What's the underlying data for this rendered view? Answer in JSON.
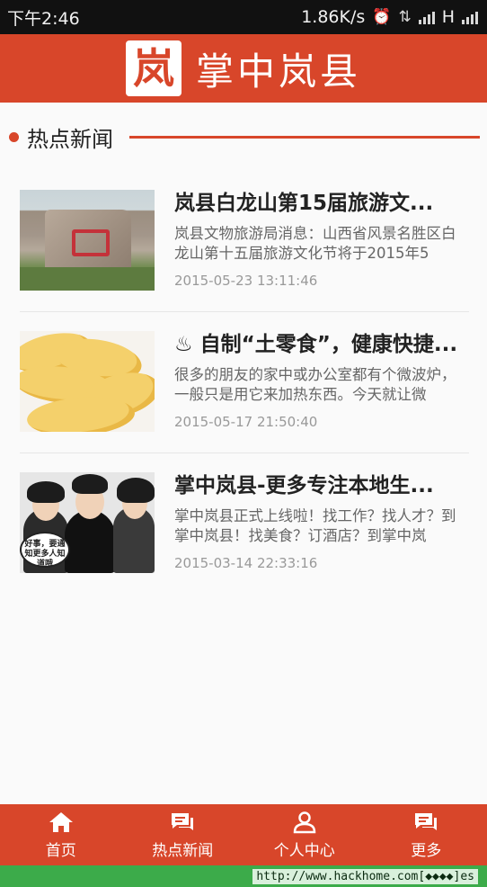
{
  "status_bar": {
    "time": "下午2:46",
    "speed": "1.86K/s",
    "network": "H"
  },
  "header": {
    "logo_char": "岚",
    "title": "掌中岚县"
  },
  "section": {
    "title": "热点新闻"
  },
  "news": [
    {
      "title": "岚县白龙山第15届旅游文...",
      "summary": "岚县文物旅游局消息：山西省风景名胜区白龙山第十五届旅游文化节将于2015年5",
      "date": "2015-05-23 13:11:46"
    },
    {
      "title": "♨ 自制“土零食”，健康快捷...",
      "summary": "很多的朋友的家中或办公室都有个微波炉，一般只是用它来加热东西。今天就让微",
      "date": "2015-05-17 21:50:40"
    },
    {
      "title": "掌中岚县-更多专注本地生...",
      "summary": "掌中岚县正式上线啦！找工作？找人才？到掌中岚县！找美食？订酒店？到掌中岚",
      "date": "2015-03-14 22:33:16",
      "image_text": "好事，要通知更多人知道哦"
    }
  ],
  "nav": [
    {
      "label": "首页",
      "icon": "home-icon"
    },
    {
      "label": "热点新闻",
      "icon": "chat-icon"
    },
    {
      "label": "个人中心",
      "icon": "person-icon"
    },
    {
      "label": "更多",
      "icon": "more-chat-icon"
    }
  ],
  "watermark": "http://www.hackhome.com[◆◆◆◆]es",
  "colors": {
    "brand": "#d8462a",
    "watermark_bar": "#3cab4a"
  }
}
